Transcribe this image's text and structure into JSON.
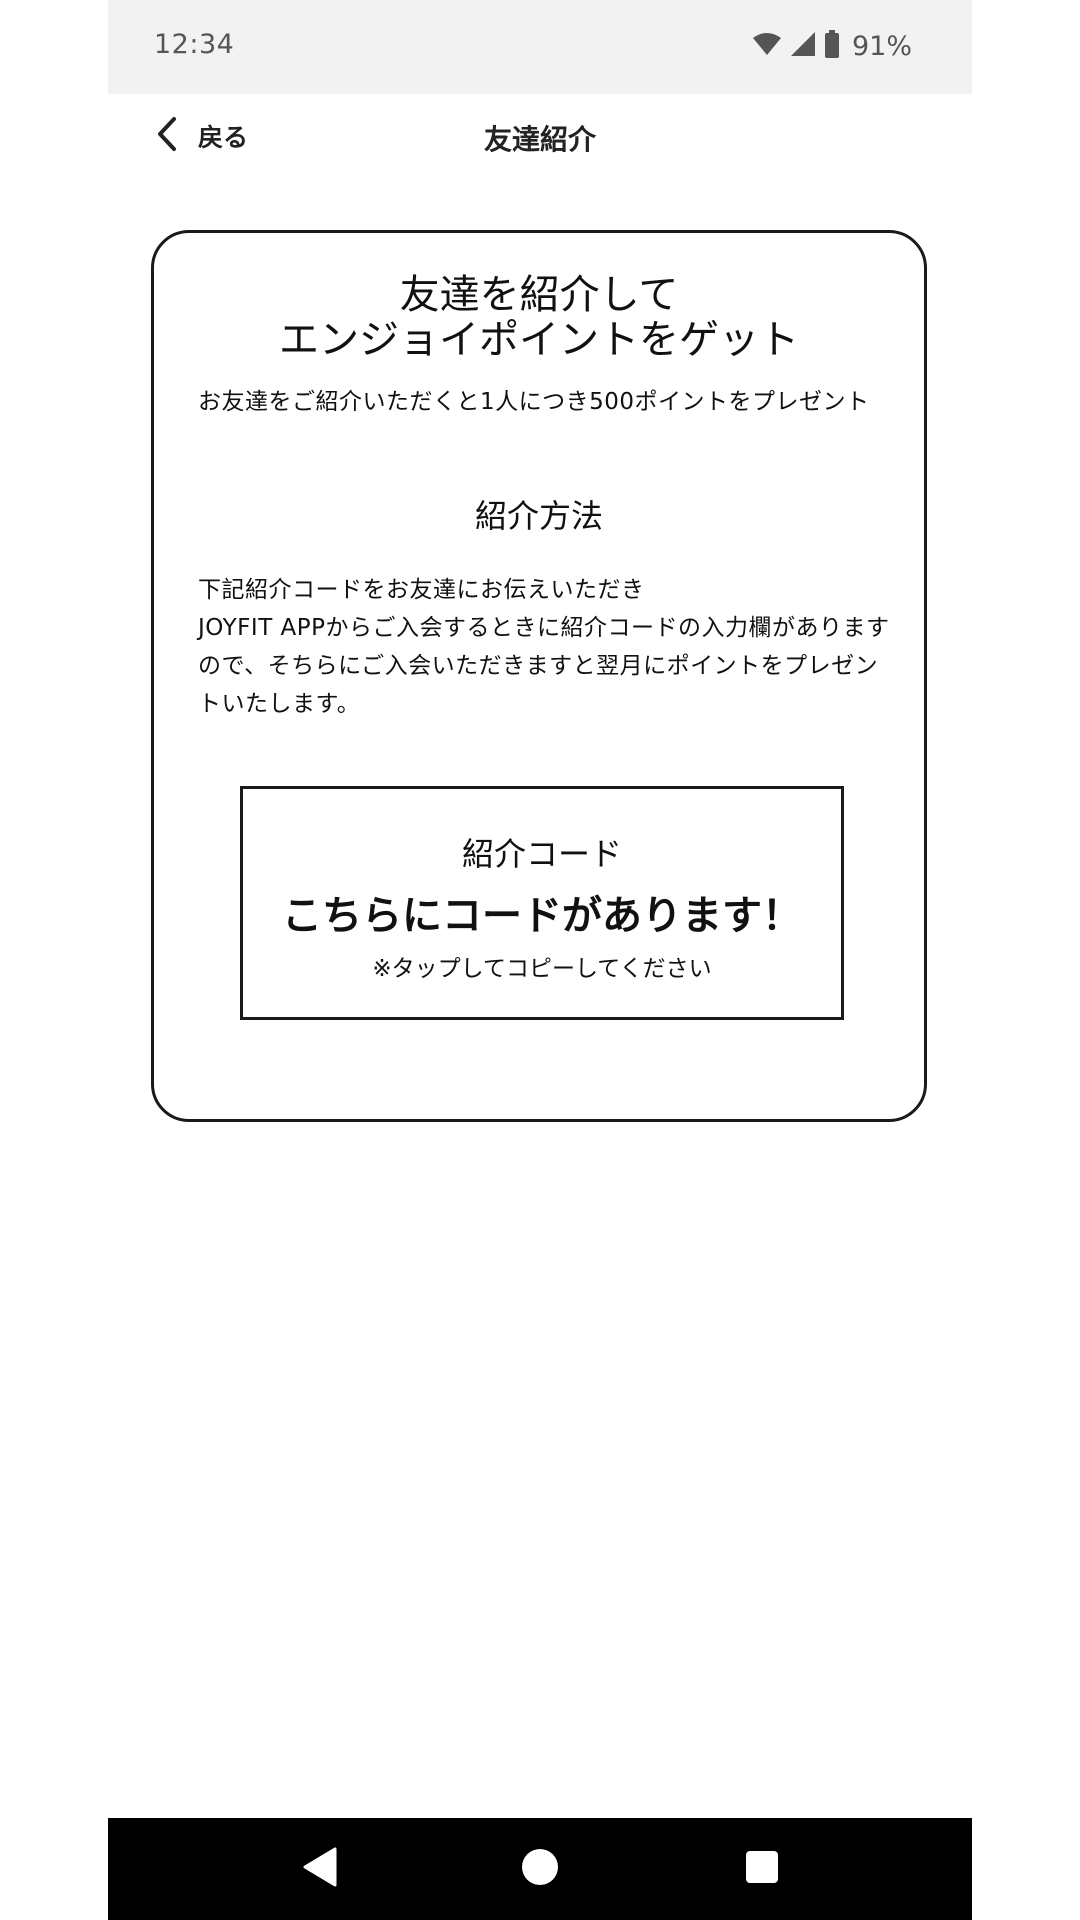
{
  "status_bar": {
    "time": "12:34",
    "battery_percent": "91%",
    "icons": [
      "wifi-icon",
      "cell-signal-icon",
      "battery-icon"
    ]
  },
  "header": {
    "back_label": "戻る",
    "title": "友達紹介"
  },
  "card": {
    "headline_line1": "友達を紹介して",
    "headline_line2": "エンジョイポイントをゲット",
    "lead": "お友達をご紹介いただくと1人につき500ポイントをプレゼント",
    "method_heading": "紹介方法",
    "method_lines": [
      "下記紹介コードをお友達にお伝えいただき",
      "JOYFIT APPからご入会するときに紹介コードの入力欄がありますので、そちらにご入会いただきますと翌月にポイントをプレゼントいたします。"
    ],
    "code_box": {
      "label": "紹介コード",
      "value": "こちらにコードがあります！",
      "note": "※タップしてコピーしてください"
    }
  },
  "nav_bar": {
    "buttons": [
      "back-nav-icon",
      "home-nav-icon",
      "recents-nav-icon"
    ]
  },
  "colors": {
    "status_bar_bg": "#f2f2f2",
    "nav_bar_bg": "#000000",
    "text": "#111111",
    "border": "#1a1a1a"
  }
}
